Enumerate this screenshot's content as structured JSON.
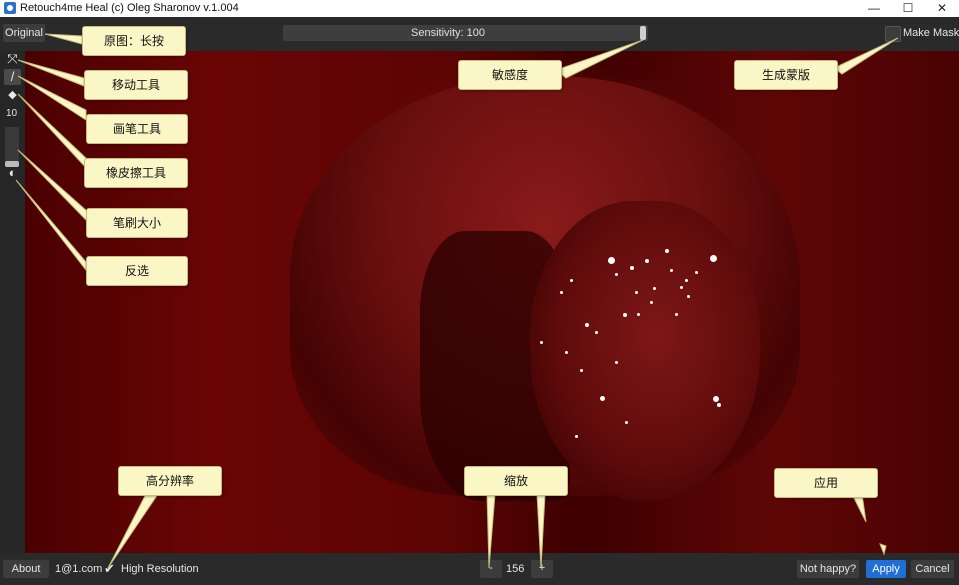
{
  "window": {
    "title": "Retouch4me Heal (c) Oleg Sharonov v.1.004",
    "minimize_glyph": "—",
    "maximize_glyph": "☐",
    "close_glyph": "✕"
  },
  "topbar": {
    "original_label": "Original",
    "sensitivity_label": "Sensitivity: 100",
    "sensitivity_value": 100,
    "make_mask_label": "Make Mask",
    "make_mask_checked": false
  },
  "toolbar": {
    "tools": [
      {
        "name": "move-icon",
        "glyph": "⤧"
      },
      {
        "name": "brush-icon",
        "glyph": "/"
      },
      {
        "name": "eraser-icon",
        "glyph": "◆"
      }
    ],
    "brush_size": "10",
    "invert_glyph": "◐"
  },
  "bottombar": {
    "about_label": "About",
    "account": "1@1.com",
    "high_res_label": "High Resolution",
    "high_res_checked": true,
    "zoom_minus": "-",
    "zoom_value": "156",
    "zoom_plus": "+",
    "not_happy_label": "Not happy?",
    "apply_label": "Apply",
    "cancel_label": "Cancel"
  },
  "callouts": {
    "original": "原图：长按",
    "move": "移动工具",
    "brush": "画笔工具",
    "eraser": "橡皮擦工具",
    "brush_size": "笔刷大小",
    "invert": "反选",
    "sensitivity": "敏感度",
    "make_mask": "生成蒙版",
    "high_res": "高分辨率",
    "zoom": "缩放",
    "apply": "应用"
  },
  "colors": {
    "apply_accent": "#1f6fd6",
    "callout_bg": "#fbf6c5",
    "mask_red": "#6a0505"
  }
}
